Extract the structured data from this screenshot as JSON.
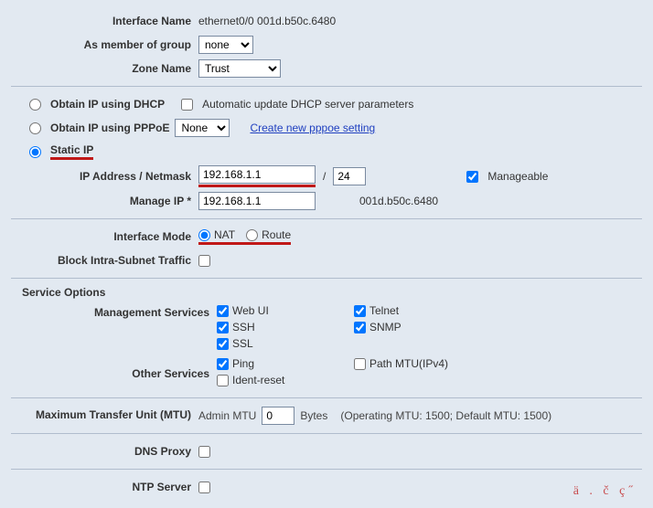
{
  "header": {
    "interface_name_label": "Interface Name",
    "interface_name_value": "ethernet0/0 001d.b50c.6480",
    "member_group_label": "As member of group",
    "member_group_value": "none",
    "zone_name_label": "Zone Name",
    "zone_name_value": "Trust"
  },
  "ip_source": {
    "dhcp_label": "Obtain IP using DHCP",
    "dhcp_auto_label": "Automatic update DHCP server parameters",
    "pppoe_label": "Obtain IP using PPPoE",
    "pppoe_select_value": "None",
    "pppoe_link": "Create new pppoe setting",
    "static_label": "Static IP",
    "ip_netmask_label": "IP Address / Netmask",
    "ip_value": "192.168.1.1",
    "slash": "/",
    "netmask_value": "24",
    "manageable_label": "Manageable",
    "manage_ip_label": "Manage IP *",
    "manage_ip_value": "192.168.1.1",
    "mac_value": "001d.b50c.6480"
  },
  "mode": {
    "interface_mode_label": "Interface Mode",
    "nat_label": "NAT",
    "route_label": "Route",
    "block_intra_label": "Block Intra-Subnet Traffic"
  },
  "services": {
    "section_title": "Service Options",
    "mgmt_label": "Management Services",
    "webui": "Web UI",
    "telnet": "Telnet",
    "ssh": "SSH",
    "snmp": "SNMP",
    "ssl": "SSL",
    "other_label": "Other Services",
    "ping": "Ping",
    "pathmtu": "Path MTU(IPv4)",
    "identreset": "Ident-reset"
  },
  "mtu": {
    "label": "Maximum Transfer Unit (MTU)",
    "admin_mtu_label": "Admin MTU",
    "admin_mtu_value": "0",
    "bytes": "Bytes",
    "info": "(Operating MTU: 1500; Default MTU: 1500)"
  },
  "dns_proxy_label": "DNS Proxy",
  "ntp_server_label": "NTP Server",
  "watermark": "ä . č   ç˝"
}
